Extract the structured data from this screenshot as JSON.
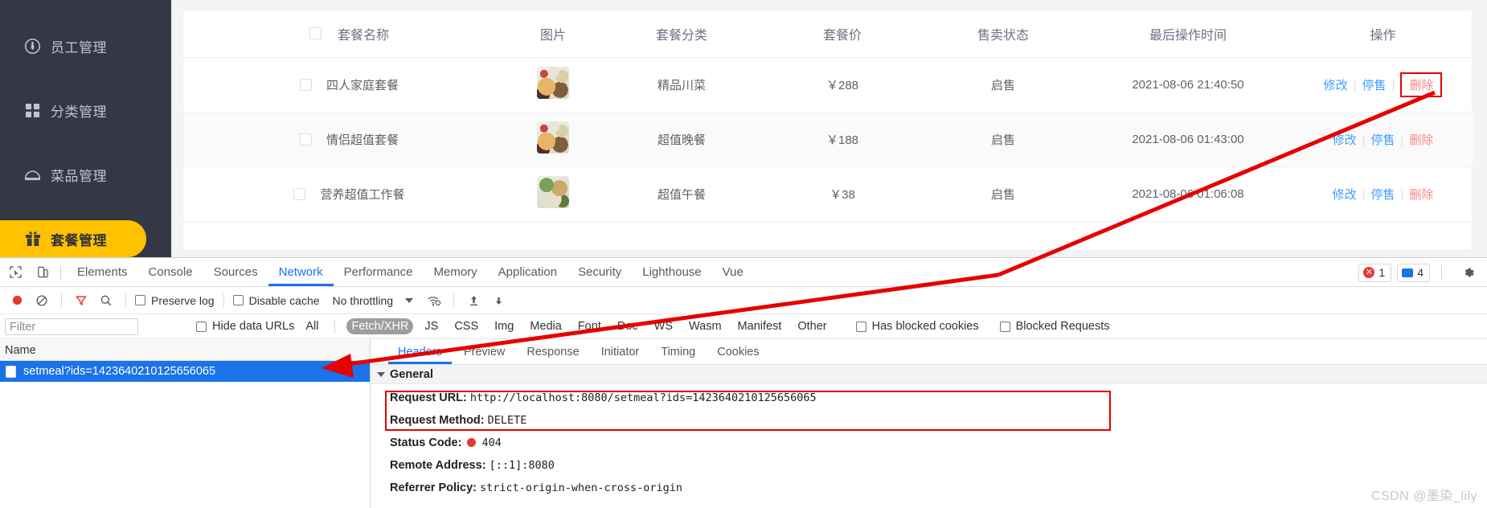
{
  "sidebar": {
    "items": [
      {
        "label": "员工管理",
        "icon": "employee-icon",
        "active": false
      },
      {
        "label": "分类管理",
        "icon": "category-grid-icon",
        "active": false
      },
      {
        "label": "菜品管理",
        "icon": "dish-cloche-icon",
        "active": false
      },
      {
        "label": "套餐管理",
        "icon": "gift-box-icon",
        "active": true
      }
    ]
  },
  "table": {
    "columns": [
      "套餐名称",
      "图片",
      "套餐分类",
      "套餐价",
      "售卖状态",
      "最后操作时间",
      "操作"
    ],
    "rows": [
      {
        "name": "四人家庭套餐",
        "category": "精品川菜",
        "price": "￥288",
        "status": "启售",
        "time": "2021-08-06 21:40:50",
        "ops": {
          "edit": "修改",
          "stop": "停售",
          "delete": "删除"
        }
      },
      {
        "name": "情侣超值套餐",
        "category": "超值晚餐",
        "price": "￥188",
        "status": "启售",
        "time": "2021-08-06 01:43:00",
        "ops": {
          "edit": "修改",
          "stop": "停售",
          "delete": "删除"
        }
      },
      {
        "name": "营养超值工作餐",
        "category": "超值午餐",
        "price": "￥38",
        "status": "启售",
        "time": "2021-08-06 01:06:08",
        "ops": {
          "edit": "修改",
          "stop": "停售",
          "delete": "删除"
        }
      }
    ]
  },
  "devtools": {
    "tabs": [
      "Elements",
      "Console",
      "Sources",
      "Network",
      "Performance",
      "Memory",
      "Application",
      "Security",
      "Lighthouse",
      "Vue"
    ],
    "selected_tab": "Network",
    "error_count": "1",
    "message_count": "4",
    "toolbar": {
      "preserve_log": "Preserve log",
      "disable_cache": "Disable cache",
      "throttling": "No throttling"
    },
    "filterbar": {
      "filter_placeholder": "Filter",
      "filter_value": "",
      "hide_data_urls": "Hide data URLs",
      "types": [
        "All",
        "Fetch/XHR",
        "JS",
        "CSS",
        "Img",
        "Media",
        "Font",
        "Doc",
        "WS",
        "Wasm",
        "Manifest",
        "Other"
      ],
      "selected_type": "Fetch/XHR",
      "has_blocked_cookies": "Has blocked cookies",
      "blocked_requests": "Blocked Requests"
    },
    "request_list": {
      "column_header": "Name",
      "rows": [
        "setmeal?ids=1423640210125656065"
      ]
    },
    "detail": {
      "tabs": [
        "Headers",
        "Preview",
        "Response",
        "Initiator",
        "Timing",
        "Cookies"
      ],
      "selected_tab": "Headers",
      "section_title": "General",
      "fields": [
        {
          "label": "Request URL:",
          "value": "http://localhost:8080/setmeal?ids=1423640210125656065"
        },
        {
          "label": "Request Method:",
          "value": "DELETE"
        },
        {
          "label": "Status Code:",
          "value": "404",
          "has_status_dot": true
        },
        {
          "label": "Remote Address:",
          "value": "[::1]:8080"
        },
        {
          "label": "Referrer Policy:",
          "value": "strict-origin-when-cross-origin"
        }
      ]
    }
  },
  "annotations": {
    "highlight_color": "#e60000",
    "watermark": "CSDN @墨染_lily"
  }
}
